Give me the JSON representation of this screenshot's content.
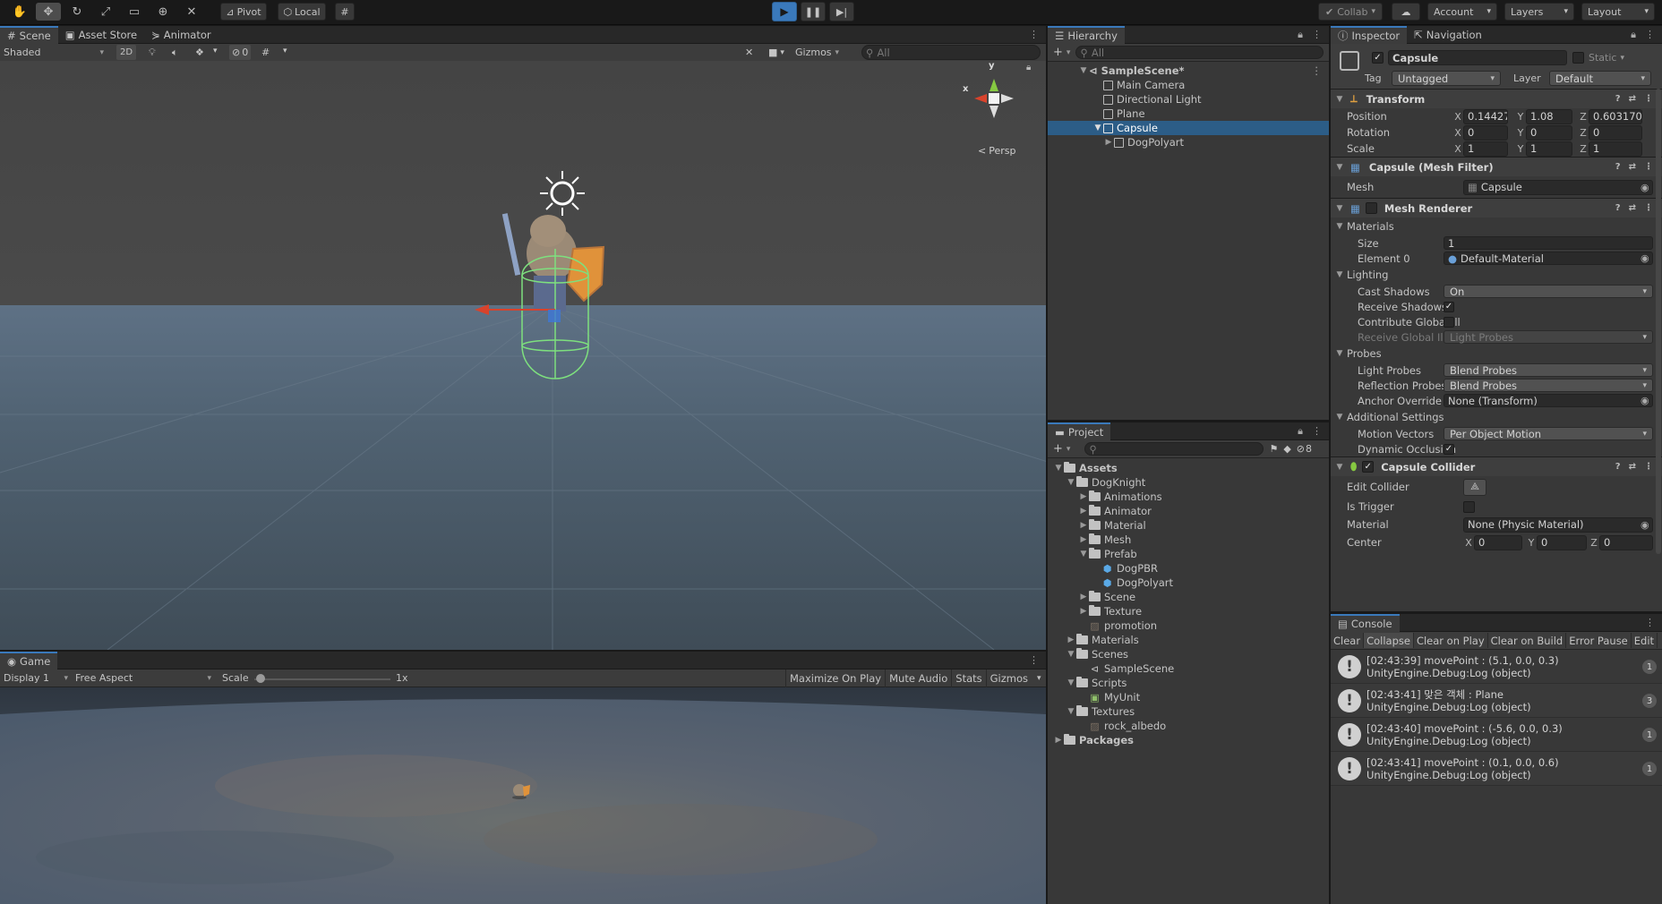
{
  "toolbar": {
    "pivot": "Pivot",
    "local": "Local",
    "collab": "Collab",
    "account": "Account",
    "layers": "Layers",
    "layout": "Layout"
  },
  "scene": {
    "tabs": [
      "Scene",
      "Asset Store",
      "Animator"
    ],
    "shading": "Shaded",
    "mode_2d": "2D",
    "hidden_count": "0",
    "gizmos": "Gizmos",
    "search_placeholder": "All",
    "persp": "Persp",
    "axis_x": "x",
    "axis_y": "y"
  },
  "game": {
    "tab": "Game",
    "display": "Display 1",
    "aspect": "Free Aspect",
    "scale_label": "Scale",
    "scale_value": "1x",
    "buttons": [
      "Maximize On Play",
      "Mute Audio",
      "Stats",
      "Gizmos"
    ]
  },
  "hierarchy": {
    "tab": "Hierarchy",
    "search_placeholder": "All",
    "scene_name": "SampleScene*",
    "items": [
      "Main Camera",
      "Directional Light",
      "Plane",
      "Capsule",
      "DogPolyart"
    ]
  },
  "project": {
    "tab": "Project",
    "hidden_count": "8",
    "items": [
      {
        "label": "Assets",
        "depth": 0,
        "kind": "folder",
        "open": true,
        "bold": true
      },
      {
        "label": "DogKnight",
        "depth": 1,
        "kind": "folder",
        "open": true
      },
      {
        "label": "Animations",
        "depth": 2,
        "kind": "folder"
      },
      {
        "label": "Animator",
        "depth": 2,
        "kind": "folder"
      },
      {
        "label": "Material",
        "depth": 2,
        "kind": "folder"
      },
      {
        "label": "Mesh",
        "depth": 2,
        "kind": "folder"
      },
      {
        "label": "Prefab",
        "depth": 2,
        "kind": "folder",
        "open": true
      },
      {
        "label": "DogPBR",
        "depth": 3,
        "kind": "prefab"
      },
      {
        "label": "DogPolyart",
        "depth": 3,
        "kind": "prefab"
      },
      {
        "label": "Scene",
        "depth": 2,
        "kind": "folder"
      },
      {
        "label": "Texture",
        "depth": 2,
        "kind": "folder"
      },
      {
        "label": "promotion",
        "depth": 2,
        "kind": "image"
      },
      {
        "label": "Materials",
        "depth": 1,
        "kind": "folder"
      },
      {
        "label": "Scenes",
        "depth": 1,
        "kind": "folder",
        "open": true
      },
      {
        "label": "SampleScene",
        "depth": 2,
        "kind": "scene"
      },
      {
        "label": "Scripts",
        "depth": 1,
        "kind": "folder",
        "open": true
      },
      {
        "label": "MyUnit",
        "depth": 2,
        "kind": "script"
      },
      {
        "label": "Textures",
        "depth": 1,
        "kind": "folder",
        "open": true
      },
      {
        "label": "rock_albedo",
        "depth": 2,
        "kind": "image"
      },
      {
        "label": "Packages",
        "depth": 0,
        "kind": "folder",
        "bold": true
      }
    ]
  },
  "inspector": {
    "tabs": [
      "Inspector",
      "Navigation"
    ],
    "object_name": "Capsule",
    "static_label": "Static",
    "tag_label": "Tag",
    "tag_value": "Untagged",
    "layer_label": "Layer",
    "layer_value": "Default",
    "transform": {
      "title": "Transform",
      "position_label": "Position",
      "rotation_label": "Rotation",
      "scale_label": "Scale",
      "position": [
        "0.144270",
        "1.08",
        "0.603170"
      ],
      "rotation": [
        "0",
        "0",
        "0"
      ],
      "scale": [
        "1",
        "1",
        "1"
      ]
    },
    "mesh_filter": {
      "title": "Capsule (Mesh Filter)",
      "mesh_label": "Mesh",
      "mesh_value": "Capsule"
    },
    "mesh_renderer": {
      "title": "Mesh Renderer",
      "materials": "Materials",
      "size_label": "Size",
      "size_value": "1",
      "element0_label": "Element 0",
      "element0_value": "Default-Material",
      "lighting": "Lighting",
      "cast_shadows_label": "Cast Shadows",
      "cast_shadows_value": "On",
      "receive_shadows_label": "Receive Shadows",
      "contribute_gi_label": "Contribute Global Illu",
      "receive_gi_label": "Receive Global Illum",
      "receive_gi_value": "Light Probes",
      "probes": "Probes",
      "light_probes_label": "Light Probes",
      "light_probes_value": "Blend Probes",
      "reflection_probes_label": "Reflection Probes",
      "reflection_probes_value": "Blend Probes",
      "anchor_override_label": "Anchor Override",
      "anchor_override_value": "None (Transform)",
      "additional": "Additional Settings",
      "motion_vectors_label": "Motion Vectors",
      "motion_vectors_value": "Per Object Motion",
      "dynamic_occlusion_label": "Dynamic Occlusion"
    },
    "capsule_collider": {
      "title": "Capsule Collider",
      "edit_collider_label": "Edit Collider",
      "is_trigger_label": "Is Trigger",
      "material_label": "Material",
      "material_value": "None (Physic Material)",
      "center_label": "Center",
      "center": [
        "0",
        "0",
        "0"
      ]
    }
  },
  "console": {
    "tab": "Console",
    "buttons": [
      "Clear",
      "Collapse",
      "Clear on Play",
      "Clear on Build",
      "Error Pause",
      "Edit"
    ],
    "entries": [
      {
        "line1": "[02:43:39] movePoint : (5.1, 0.0, 0.3)",
        "line2": "UnityEngine.Debug:Log (object)",
        "count": "1"
      },
      {
        "line1": "[02:43:41] 맞은 객체 : Plane",
        "line2": "UnityEngine.Debug:Log (object)",
        "count": "3"
      },
      {
        "line1": "[02:43:40] movePoint : (-5.6, 0.0, 0.3)",
        "line2": "UnityEngine.Debug:Log (object)",
        "count": "1"
      },
      {
        "line1": "[02:43:41] movePoint : (0.1, 0.0, 0.6)",
        "line2": "UnityEngine.Debug:Log (object)",
        "count": "1"
      }
    ]
  },
  "colors": {
    "accent": "#3a79bb",
    "selection": "#2c5d87",
    "panel": "#383838"
  }
}
